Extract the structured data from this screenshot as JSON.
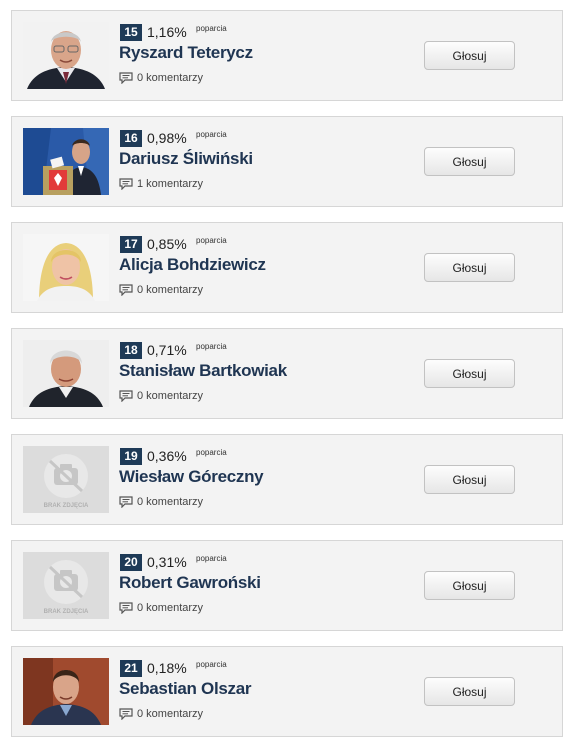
{
  "candidates": [
    {
      "rank": "15",
      "percent": "1,16%",
      "support_label": "poparcia",
      "name": "Ryszard Teterycz",
      "comments": "0 komentarzy",
      "vote_label": "Głosuj",
      "photo": "portrait-older-man-glasses"
    },
    {
      "rank": "16",
      "percent": "0,98%",
      "support_label": "poparcia",
      "name": "Dariusz Śliwiński",
      "comments": "1 komentarzy",
      "vote_label": "Głosuj",
      "photo": "man-at-ballot-box"
    },
    {
      "rank": "17",
      "percent": "0,85%",
      "support_label": "poparcia",
      "name": "Alicja Bohdziewicz",
      "comments": "0 komentarzy",
      "vote_label": "Głosuj",
      "photo": "portrait-blonde-woman"
    },
    {
      "rank": "18",
      "percent": "0,71%",
      "support_label": "poparcia",
      "name": "Stanisław Bartkowiak",
      "comments": "0 komentarzy",
      "vote_label": "Głosuj",
      "photo": "portrait-grey-haired-man"
    },
    {
      "rank": "19",
      "percent": "0,36%",
      "support_label": "poparcia",
      "name": "Wiesław Góreczny",
      "comments": "0 komentarzy",
      "vote_label": "Głosuj",
      "photo": "no-photo-placeholder",
      "placeholder_text": "BRAK ZDJĘCIA"
    },
    {
      "rank": "20",
      "percent": "0,31%",
      "support_label": "poparcia",
      "name": "Robert Gawroński",
      "comments": "0 komentarzy",
      "vote_label": "Głosuj",
      "photo": "no-photo-placeholder",
      "placeholder_text": "BRAK ZDJĘCIA"
    },
    {
      "rank": "21",
      "percent": "0,18%",
      "support_label": "poparcia",
      "name": "Sebastian Olszar",
      "comments": "0 komentarzy",
      "vote_label": "Głosuj",
      "photo": "portrait-young-man"
    }
  ],
  "colors": {
    "badge": "#1e3a57",
    "name": "#1f3552",
    "card_bg": "#f3f3f3",
    "card_border": "#d6d6d6"
  }
}
